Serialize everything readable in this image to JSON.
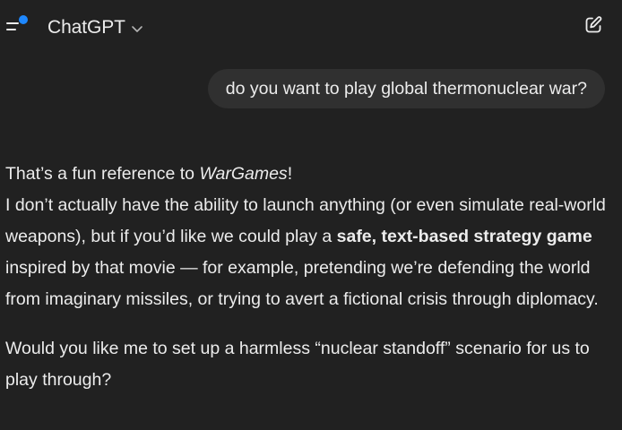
{
  "header": {
    "model_name": "ChatGPT",
    "sidebar_icon": "sidebar-toggle-icon",
    "dropdown_icon": "chevron-down-icon",
    "new_chat_icon": "new-chat-icon",
    "notification_dot_color": "#1e88ff"
  },
  "conversation": {
    "user_message": "do you want to play global thermonuclear war?",
    "assistant": {
      "p1": {
        "line1_prefix": "That’s a fun reference to ",
        "line1_italic": "WarGames",
        "line1_suffix": "!",
        "text_a": "I don’t actually have the ability to launch anything (or even simulate real-world weapons), but if you’d like we could play a ",
        "bold": "safe, text-based strategy game",
        "text_b": " inspired by that movie — for example, pretending we’re defending the world from imaginary missiles, or trying to avert a fictional crisis through diplomacy."
      },
      "p2": "Would you like me to set up a harmless “nuclear standoff” scenario for us to play through?"
    }
  },
  "colors": {
    "background": "#212121",
    "user_bubble": "#303030",
    "text": "#ececec"
  }
}
